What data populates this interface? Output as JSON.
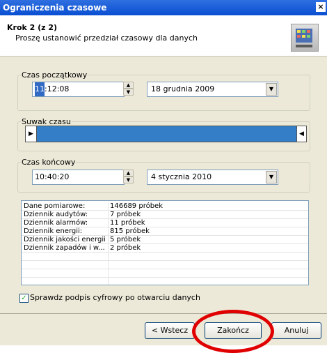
{
  "window": {
    "title": "Ograniczenia czasowe",
    "close_glyph": "×"
  },
  "header": {
    "step": "Krok 2 (z 2)",
    "description": "Proszę ustanowić przedział czasowy dla danych",
    "icon": "device-icon"
  },
  "start": {
    "legend": "Czas początkowy",
    "time_highlight": "11",
    "time_rest": ":12:08",
    "date": "18   grudnia   2009"
  },
  "slider": {
    "legend": "Suwak czasu",
    "left_glyph": "▶",
    "right_glyph": "◀"
  },
  "end": {
    "legend": "Czas końcowy",
    "time": "10:40:20",
    "date": "4   stycznia   2010"
  },
  "spin_up": "▲",
  "spin_down": "▼",
  "combo_arrow": "▼",
  "summary": {
    "rows": [
      {
        "label": "Dane pomiarowe:",
        "value": "146689 próbek"
      },
      {
        "label": "Dziennik audytów:",
        "value": "7 próbek"
      },
      {
        "label": "Dziennik alarmów:",
        "value": "11 próbek"
      },
      {
        "label": "Dziennik energii:",
        "value": "815 próbek"
      },
      {
        "label": "Dziennik jakości energii:",
        "value": "5 próbek"
      },
      {
        "label": "Dziennik zapadów i w...",
        "value": "2 próbek"
      }
    ]
  },
  "verify": {
    "label": "Sprawdz podpis cyfrowy po otwarciu danych",
    "checked": true,
    "check_glyph": "✓"
  },
  "buttons": {
    "back": "< Wstecz",
    "finish": "Zakończ",
    "cancel": "Anuluj"
  },
  "colors": {
    "title_bar": "#0a4fd2",
    "slider_fill": "#337ec7",
    "highlight_ring": "#e00000"
  }
}
